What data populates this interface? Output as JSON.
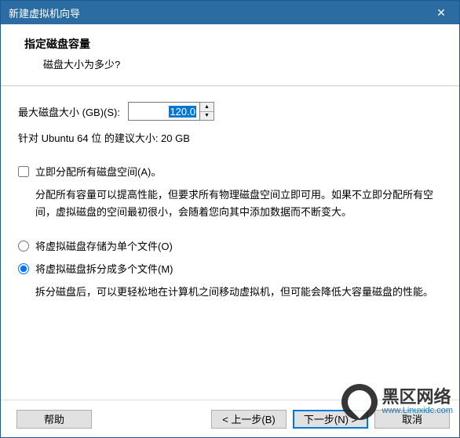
{
  "window": {
    "title": "新建虚拟机向导"
  },
  "header": {
    "title": "指定磁盘容量",
    "subtitle": "磁盘大小为多少?"
  },
  "disk": {
    "label": "最大磁盘大小 (GB)(S):",
    "value_int": "120.0",
    "value_dec": "",
    "recommended": "针对 Ubuntu 64 位 的建议大小: 20 GB"
  },
  "allocate": {
    "checkbox_label": "立即分配所有磁盘空间(A)。",
    "desc": "分配所有容量可以提高性能，但要求所有物理磁盘空间立即可用。如果不立即分配所有空间，虚拟磁盘的空间最初很小，会随着您向其中添加数据而不断变大。"
  },
  "store": {
    "single_label": "将虚拟磁盘存储为单个文件(O)",
    "split_label": "将虚拟磁盘拆分成多个文件(M)",
    "split_desc": "拆分磁盘后，可以更轻松地在计算机之间移动虚拟机，但可能会降低大容量磁盘的性能。"
  },
  "buttons": {
    "help": "帮助",
    "back": "< 上一步(B)",
    "next": "下一步(N) >",
    "cancel": "取消"
  },
  "watermark": {
    "text": "黑区网络",
    "url": "www.Linuxidc.com"
  }
}
